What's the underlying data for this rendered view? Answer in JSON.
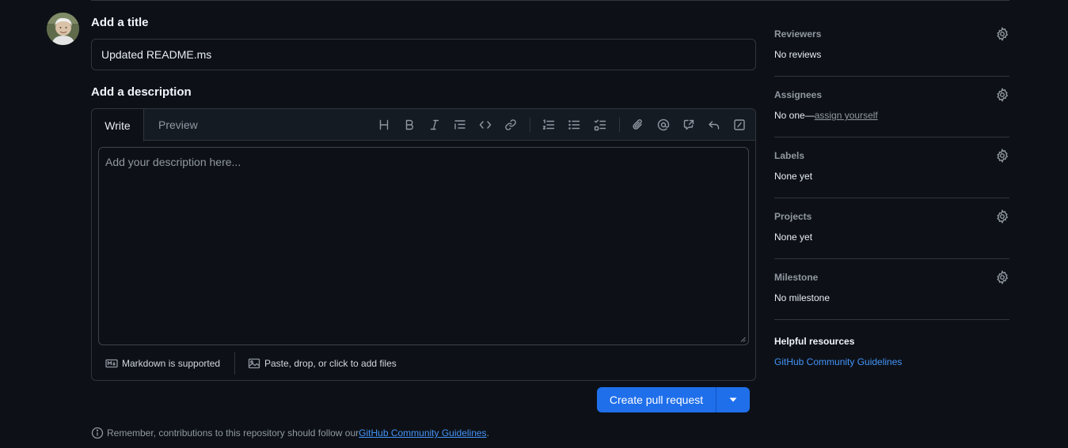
{
  "title_section": {
    "heading": "Add a title",
    "input_value": "Updated README.ms"
  },
  "description_section": {
    "heading": "Add a description",
    "tabs": [
      "Write",
      "Preview"
    ],
    "placeholder": "Add your description here...",
    "toolbar_icons": [
      "heading-icon",
      "bold-icon",
      "italic-icon",
      "quote-icon",
      "code-icon",
      "link-icon",
      "numbered-list-icon",
      "unordered-list-icon",
      "task-list-icon",
      "attach-icon",
      "mention-icon",
      "reference-icon",
      "undo-icon",
      "slash-command-icon"
    ],
    "markdown_note": "Markdown is supported",
    "attach_note": "Paste, drop, or click to add files"
  },
  "actions": {
    "create_label": "Create pull request"
  },
  "footer_note": {
    "text_before": "Remember, contributions to this repository should follow our ",
    "link_text": "GitHub Community Guidelines",
    "text_after": "."
  },
  "sidebar": {
    "reviewers": {
      "title": "Reviewers",
      "value": "No reviews"
    },
    "assignees": {
      "title": "Assignees",
      "value_prefix": "No one—",
      "value_link": "assign yourself"
    },
    "labels": {
      "title": "Labels",
      "value": "None yet"
    },
    "projects": {
      "title": "Projects",
      "value": "None yet"
    },
    "milestone": {
      "title": "Milestone",
      "value": "No milestone"
    },
    "helpful": {
      "title": "Helpful resources",
      "link": "GitHub Community Guidelines"
    }
  },
  "colors": {
    "background": "#0d1117",
    "primary_button": "#1f6feb",
    "link": "#4493f8",
    "border": "#30363d"
  }
}
